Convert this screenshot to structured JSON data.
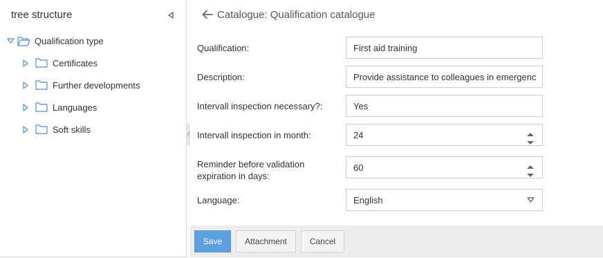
{
  "tree": {
    "title": "tree structure",
    "root": {
      "label": "Qualification type",
      "expanded": true
    },
    "children": [
      {
        "label": "Certificates"
      },
      {
        "label": "Further developments"
      },
      {
        "label": "Languages"
      },
      {
        "label": "Soft skills"
      }
    ]
  },
  "header": {
    "title": "Catalogue: Qualification catalogue"
  },
  "form": {
    "qualification": {
      "label": "Qualification:",
      "value": "First aid training"
    },
    "description": {
      "label": "Description:",
      "value": "Provide assistance to colleagues in emergenc"
    },
    "interval_necessary": {
      "label": "Intervall inspection necessary?:",
      "value": "Yes"
    },
    "interval_months": {
      "label": "Intervall inspection in month:",
      "value": "24"
    },
    "reminder_days": {
      "label_line1": "Reminder before validation",
      "label_line2": "expiration in days:",
      "value": "60"
    },
    "language": {
      "label": "Language:",
      "value": "English"
    }
  },
  "buttons": {
    "save": "Save",
    "attachment": "Attachment",
    "cancel": "Cancel"
  },
  "colors": {
    "accent": "#5da0e0",
    "icon": "#4a8fd4",
    "button_bar": "#ececec"
  }
}
